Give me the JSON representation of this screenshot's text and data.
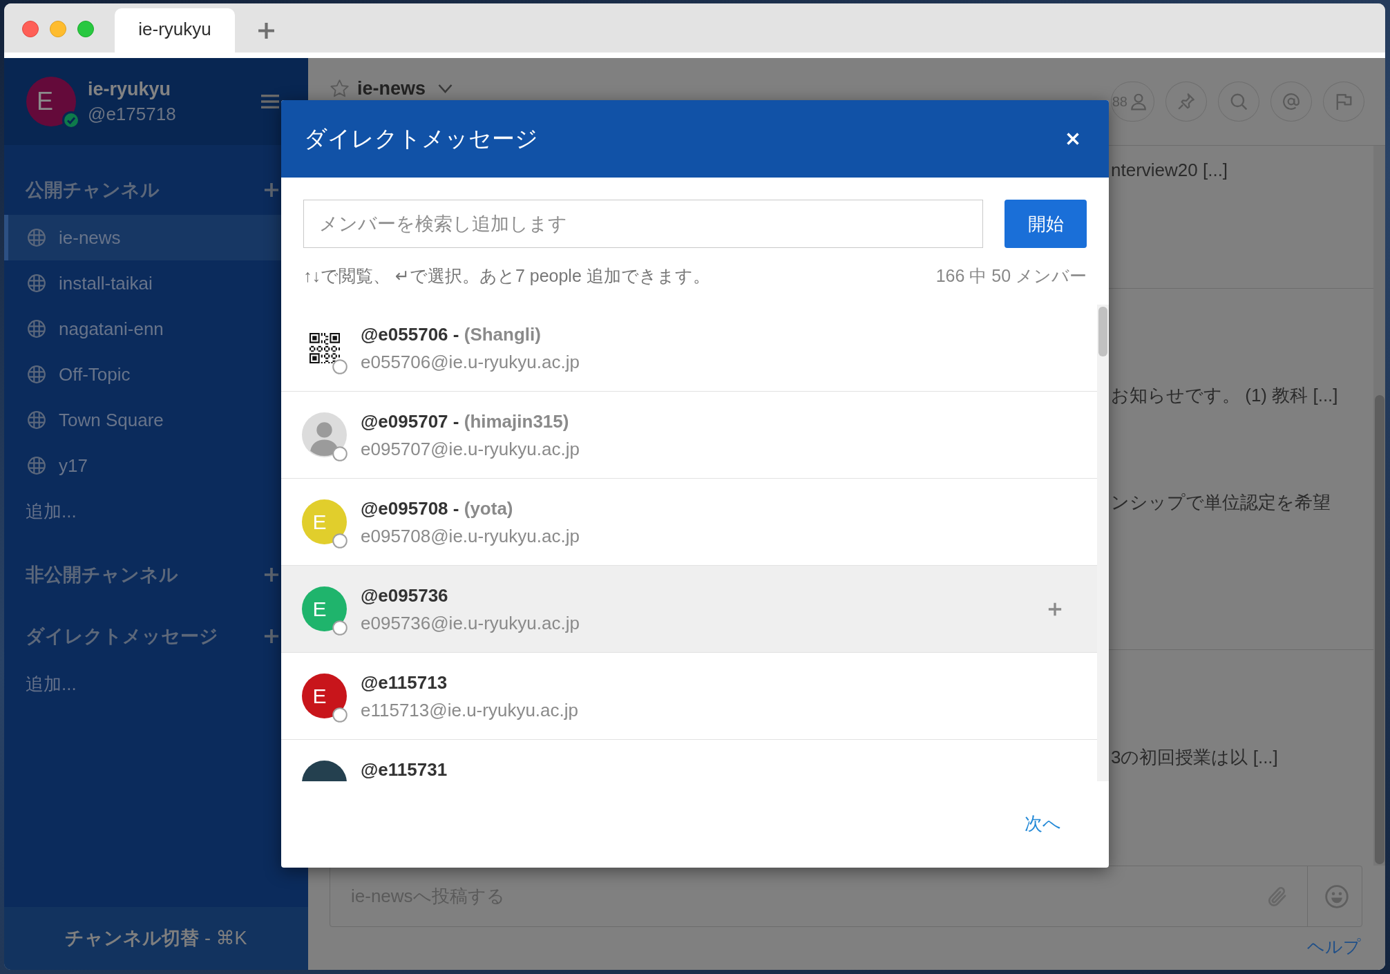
{
  "tabs": [
    {
      "label": "ie-ryukyu",
      "selected": true
    }
  ],
  "sidebar": {
    "team": "ie-ryukyu",
    "user": {
      "initial": "E",
      "handle": "@e175718",
      "online": true
    },
    "sections": [
      {
        "title": "公開チャンネル",
        "channels": [
          {
            "name": "ie-news",
            "selected": true
          },
          {
            "name": "install-taikai",
            "selected": false
          },
          {
            "name": "nagatani-enn",
            "selected": false
          },
          {
            "name": "Off-Topic",
            "selected": false
          },
          {
            "name": "Town Square",
            "selected": false
          },
          {
            "name": "y17",
            "selected": false
          }
        ],
        "more": "追加..."
      },
      {
        "title": "非公開チャンネル"
      },
      {
        "title": "ダイレクトメッセージ",
        "more": "追加..."
      }
    ],
    "switcher": "**チャンネル切替** - ⌘K"
  },
  "channel_header": {
    "name": "ie-news",
    "favorite": false,
    "member_count": "88"
  },
  "posts": [
    {
      "lines": [
        "nterview20 [...]"
      ]
    },
    {
      "lines": [
        "お知らせです。 (1) 教科 [...]",
        "ンシップで単位認定を希望"
      ]
    },
    {
      "lines": [
        "3の初回授業は以 [...]"
      ]
    }
  ],
  "composer": {
    "placeholder": "ie-newsへ投稿する",
    "help": "ヘルプ"
  },
  "dialog": {
    "title": "ダイレクトメッセージ",
    "search": {
      "placeholder": "メンバーを検索し追加します"
    },
    "start_button": "開始",
    "hint": "↑↓で閲覧、 ↵で選択。あと7 people 追加できます。",
    "count": "166 中 50 メンバー",
    "members": [
      {
        "username": "@e055706",
        "separator": "-",
        "nickname": "(Shangli)",
        "email": "e055706@ie.u-ryukyu.ac.jp",
        "avatar": {
          "kind": "qr"
        },
        "online": false,
        "selected": false
      },
      {
        "username": "@e095707",
        "separator": "-",
        "nickname": "(himajin315)",
        "email": "e095707@ie.u-ryukyu.ac.jp",
        "avatar": {
          "kind": "picture"
        },
        "online": false,
        "selected": false
      },
      {
        "username": "@e095708",
        "separator": "-",
        "nickname": "(yota)",
        "email": "e095708@ie.u-ryukyu.ac.jp",
        "avatar": {
          "kind": "letter",
          "letter": "E",
          "color": "#e1ce2c"
        },
        "online": false,
        "selected": false
      },
      {
        "username": "@e095736",
        "email": "e095736@ie.u-ryukyu.ac.jp",
        "avatar": {
          "kind": "letter",
          "letter": "E",
          "color": "#1fb46c"
        },
        "online": false,
        "selected": true
      },
      {
        "username": "@e115713",
        "email": "e115713@ie.u-ryukyu.ac.jp",
        "avatar": {
          "kind": "letter",
          "letter": "E",
          "color": "#c8151b"
        },
        "online": false,
        "selected": false
      },
      {
        "username": "@e115731",
        "avatar": {
          "kind": "photo"
        },
        "selected": false
      }
    ],
    "next": "次へ"
  }
}
